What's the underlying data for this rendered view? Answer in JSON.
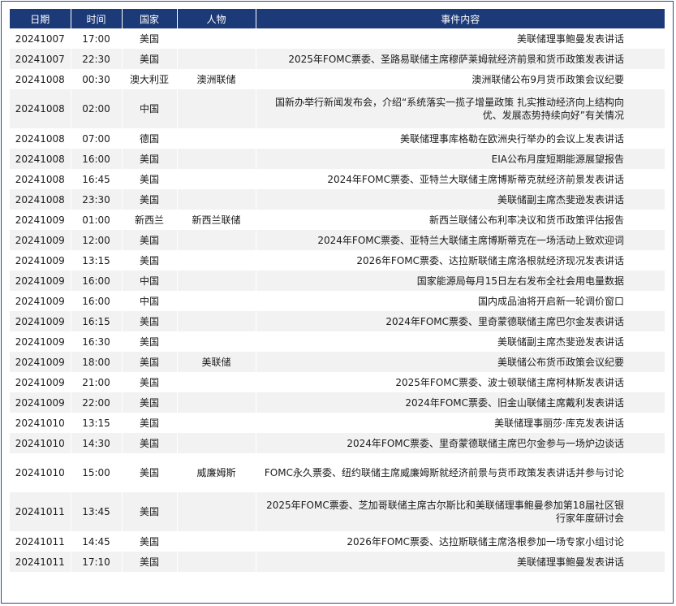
{
  "headers": {
    "date": "日期",
    "time": "时间",
    "country": "国家",
    "person": "人物",
    "event": "事件内容"
  },
  "rows": [
    {
      "date": "20241007",
      "time": "17:00",
      "country": "美国",
      "person": "",
      "event": "美联储理事鲍曼发表讲话"
    },
    {
      "date": "20241007",
      "time": "22:30",
      "country": "美国",
      "person": "",
      "event": "2025年FOMC票委、圣路易联储主席穆萨莱姆就经济前景和货币政策发表讲话"
    },
    {
      "date": "20241008",
      "time": "00:30",
      "country": "澳大利亚",
      "person": "澳洲联储",
      "event": "澳洲联储公布9月货币政策会议纪要"
    },
    {
      "date": "20241008",
      "time": "02:00",
      "country": "中国",
      "person": "",
      "event": "国新办举行新闻发布会，介绍“系统落实一揽子增量政策 扎实推动经济向上结构向优、发展态势持续向好”有关情况"
    },
    {
      "date": "20241008",
      "time": "07:00",
      "country": "德国",
      "person": "",
      "event": "美联储理事库格勒在欧洲央行举办的会议上发表讲话"
    },
    {
      "date": "20241008",
      "time": "16:00",
      "country": "美国",
      "person": "",
      "event": "EIA公布月度短期能源展望报告"
    },
    {
      "date": "20241008",
      "time": "16:45",
      "country": "美国",
      "person": "",
      "event": "2024年FOMC票委、亚特兰大联储主席博斯蒂克就经济前景发表讲话"
    },
    {
      "date": "20241008",
      "time": "23:30",
      "country": "美国",
      "person": "",
      "event": "美联储副主席杰斐逊发表讲话"
    },
    {
      "date": "20241009",
      "time": "01:00",
      "country": "新西兰",
      "person": "新西兰联储",
      "event": "新西兰联储公布利率决议和货币政策评估报告"
    },
    {
      "date": "20241009",
      "time": "12:00",
      "country": "美国",
      "person": "",
      "event": "2024年FOMC票委、亚特兰大联储主席博斯蒂克在一场活动上致欢迎词"
    },
    {
      "date": "20241009",
      "time": "13:15",
      "country": "美国",
      "person": "",
      "event": "2026年FOMC票委、达拉斯联储主席洛根就经济现况发表讲话"
    },
    {
      "date": "20241009",
      "time": "16:00",
      "country": "中国",
      "person": "",
      "event": "国家能源局每月15日左右发布全社会用电量数据"
    },
    {
      "date": "20241009",
      "time": "16:00",
      "country": "中国",
      "person": "",
      "event": "国内成品油将开启新一轮调价窗口"
    },
    {
      "date": "20241009",
      "time": "16:15",
      "country": "美国",
      "person": "",
      "event": "2024年FOMC票委、里奇蒙德联储主席巴尔金发表讲话"
    },
    {
      "date": "20241009",
      "time": "16:30",
      "country": "美国",
      "person": "",
      "event": "美联储副主席杰斐逊发表讲话"
    },
    {
      "date": "20241009",
      "time": "18:00",
      "country": "美国",
      "person": "美联储",
      "event": "美联储公布货币政策会议纪要"
    },
    {
      "date": "20241009",
      "time": "21:00",
      "country": "美国",
      "person": "",
      "event": "2025年FOMC票委、波士顿联储主席柯林斯发表讲话"
    },
    {
      "date": "20241009",
      "time": "22:00",
      "country": "美国",
      "person": "",
      "event": "2024年FOMC票委、旧金山联储主席戴利发表讲话"
    },
    {
      "date": "20241010",
      "time": "13:15",
      "country": "美国",
      "person": "",
      "event": "美联储理事丽莎·库克发表讲话"
    },
    {
      "date": "20241010",
      "time": "14:30",
      "country": "美国",
      "person": "",
      "event": "2024年FOMC票委、里奇蒙德联储主席巴尔金参与一场炉边谈话"
    },
    {
      "date": "20241010",
      "time": "15:00",
      "country": "美国",
      "person": "威廉姆斯",
      "event": "FOMC永久票委、纽约联储主席威廉姆斯就经济前景与货币政策发表讲话并参与讨论"
    },
    {
      "date": "20241011",
      "time": "13:45",
      "country": "美国",
      "person": "",
      "event": "2025年FOMC票委、芝加哥联储主席古尔斯比和美联储理事鲍曼参加第18届社区银行家年度研讨会"
    },
    {
      "date": "20241011",
      "time": "14:45",
      "country": "美国",
      "person": "",
      "event": "2026年FOMC票委、达拉斯联储主席洛根参加一场专家小组讨论"
    },
    {
      "date": "20241011",
      "time": "17:10",
      "country": "美国",
      "person": "",
      "event": "美联储理事鲍曼发表讲话"
    }
  ]
}
